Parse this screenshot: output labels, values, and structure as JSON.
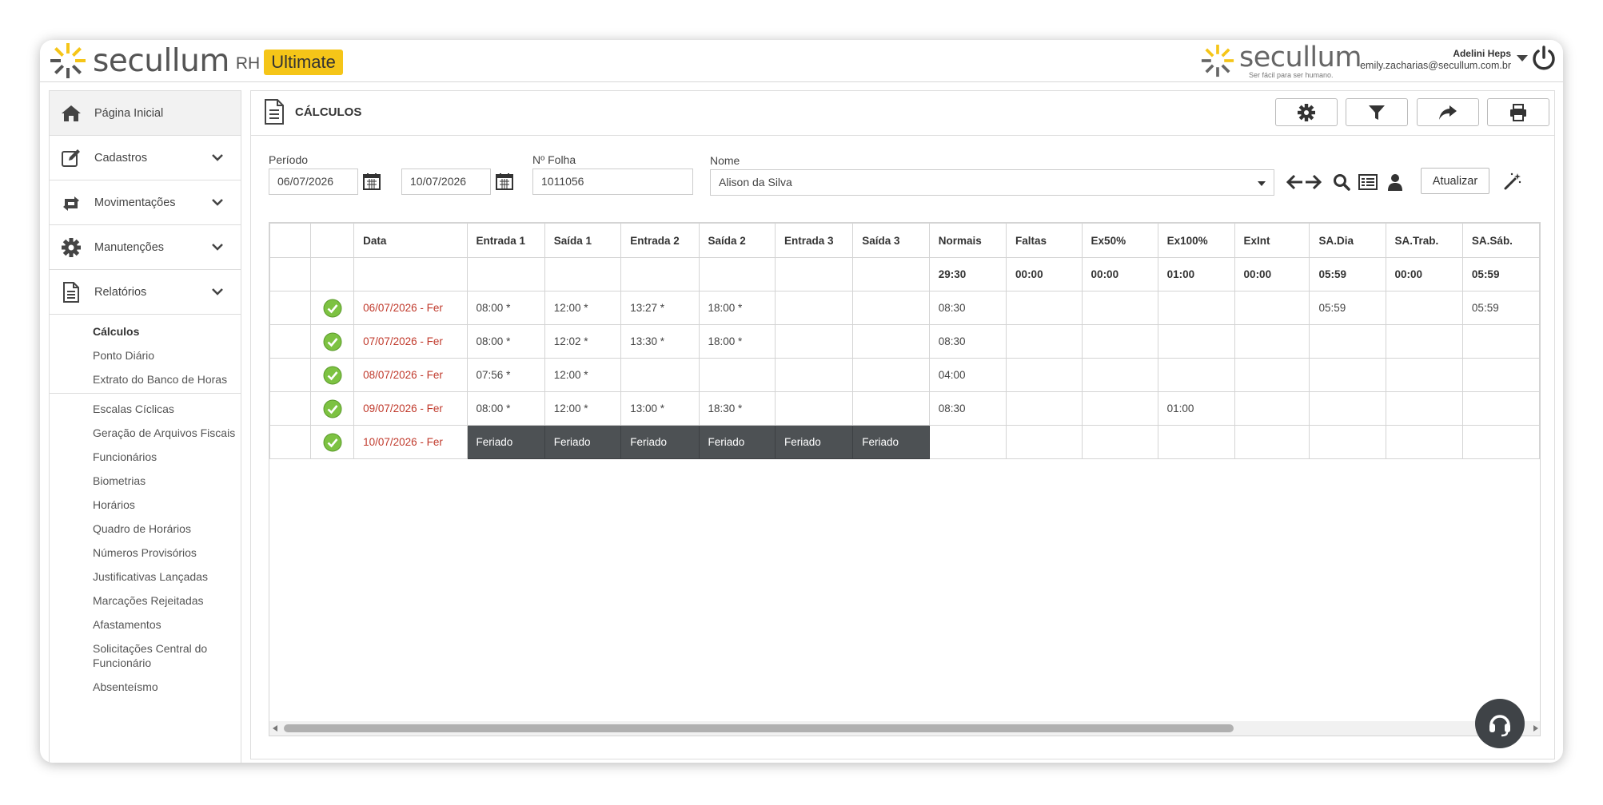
{
  "header": {
    "logo_text": "secullum",
    "logo_rh": "RH",
    "logo_badge": "Ultimate",
    "brand_text": "secullum",
    "brand_tagline": "Ser fácil para ser humano.",
    "user_name": "Adelini Heps",
    "user_email": "emily.zacharias@secullum.com.br"
  },
  "sidebar": {
    "home": "Página Inicial",
    "sections": [
      "Cadastros",
      "Movimentações",
      "Manutenções",
      "Relatórios"
    ],
    "reports_group1": [
      "Cálculos",
      "Ponto Diário",
      "Extrato do Banco de Horas"
    ],
    "reports_group2": [
      "Escalas Cíclicas",
      "Geração de Arquivos Fiscais",
      "Funcionários",
      "Biometrias",
      "Horários",
      "Quadro de Horários",
      "Números Provisórios",
      "Justificativas Lançadas",
      "Marcações Rejeitadas",
      "Afastamentos",
      "Solicitações Central do Funcionário",
      "Absenteísmo"
    ]
  },
  "main": {
    "title": "CÁLCULOS",
    "filters": {
      "periodo_label": "Período",
      "date_start": "06/07/2026",
      "date_end": "10/07/2026",
      "folha_label": "Nº Folha",
      "folha_value": "1011056",
      "nome_label": "Nome",
      "nome_value": "Alison da Silva",
      "atualizar": "Atualizar"
    }
  },
  "table": {
    "headers": [
      "",
      "",
      "Data",
      "Entrada 1",
      "Saída 1",
      "Entrada 2",
      "Saída 2",
      "Entrada 3",
      "Saída 3",
      "Normais",
      "Faltas",
      "Ex50%",
      "Ex100%",
      "ExInt",
      "SA.Dia",
      "SA.Trab.",
      "SA.Sáb."
    ],
    "totals": [
      "",
      "",
      "",
      "",
      "",
      "",
      "",
      "",
      "",
      "29:30",
      "00:00",
      "00:00",
      "01:00",
      "00:00",
      "05:59",
      "00:00",
      "05:59"
    ],
    "rows": [
      {
        "date": "06/07/2026 - Fer",
        "cells": [
          "08:00 *",
          "12:00 *",
          "13:27 *",
          "18:00 *",
          "",
          "",
          "08:30",
          "",
          "",
          "",
          "",
          "05:59",
          "",
          "05:59"
        ],
        "holiday": false
      },
      {
        "date": "07/07/2026 - Fer",
        "cells": [
          "08:00 *",
          "12:02 *",
          "13:30 *",
          "18:00 *",
          "",
          "",
          "08:30",
          "",
          "",
          "",
          "",
          "",
          "",
          ""
        ],
        "holiday": false
      },
      {
        "date": "08/07/2026 - Fer",
        "cells": [
          "07:56 *",
          "12:00 *",
          "",
          "",
          "",
          "",
          "04:00",
          "",
          "",
          "",
          "",
          "",
          "",
          ""
        ],
        "holiday": false
      },
      {
        "date": "09/07/2026 - Fer",
        "cells": [
          "08:00 *",
          "12:00 *",
          "13:00 *",
          "18:30 *",
          "",
          "",
          "08:30",
          "",
          "",
          "01:00",
          "",
          "",
          "",
          ""
        ],
        "holiday": false
      },
      {
        "date": "10/07/2026 - Fer",
        "cells": [
          "Feriado",
          "Feriado",
          "Feriado",
          "Feriado",
          "Feriado",
          "Feriado",
          "",
          "",
          "",
          "",
          "",
          "",
          "",
          ""
        ],
        "holiday": true
      }
    ]
  },
  "colors": {
    "accent": "#f5c518",
    "date_red": "#c0392b",
    "holiday_bg": "#4d5154",
    "ok_green": "#7dc242"
  }
}
